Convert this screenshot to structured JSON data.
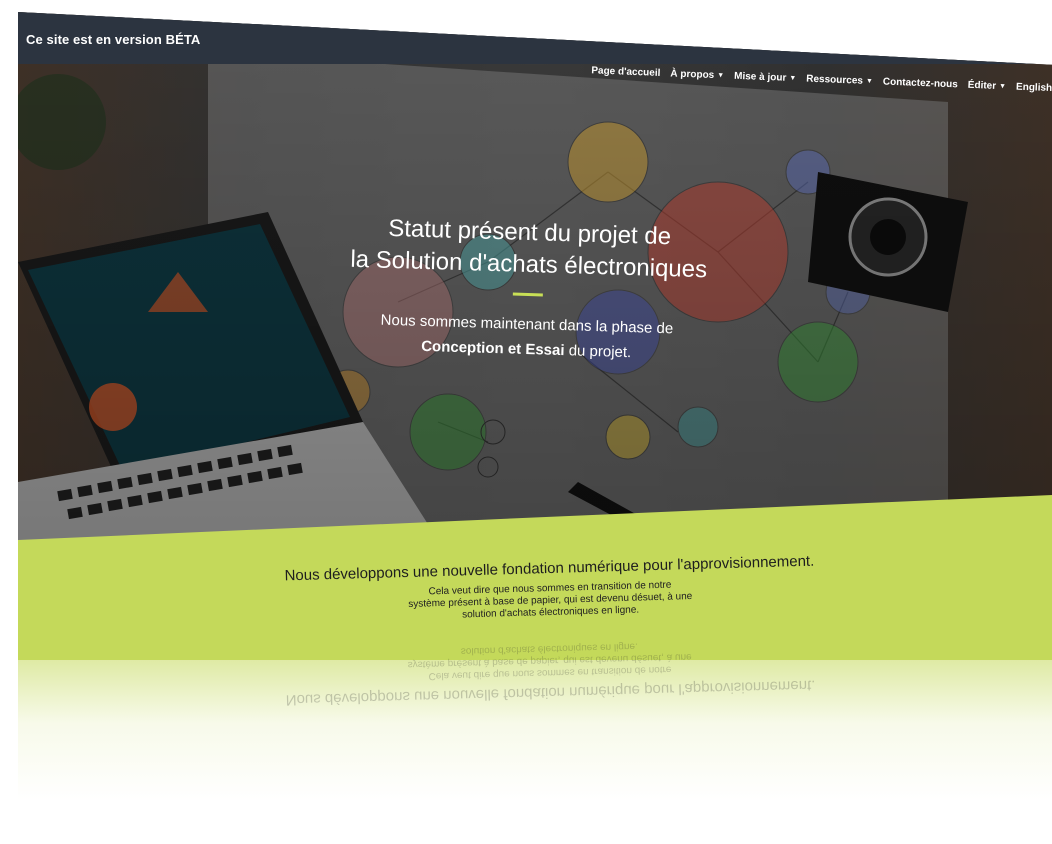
{
  "beta_notice": "Ce site est en version BÉTA",
  "nav": {
    "items": [
      {
        "label": "Page d'accueil",
        "caret": false
      },
      {
        "label": "À propos",
        "caret": true
      },
      {
        "label": "Mise à jour",
        "caret": true
      },
      {
        "label": "Ressources",
        "caret": true
      },
      {
        "label": "Contactez-nous",
        "caret": false
      },
      {
        "label": "Éditer",
        "caret": true
      },
      {
        "label": "English",
        "caret": false
      }
    ]
  },
  "hero": {
    "title_line1": "Statut présent du projet de",
    "title_line2": "la Solution d'achats électroniques",
    "subtitle_line1": "Nous sommes maintenant dans la phase de",
    "subtitle_bold": "Conception et Essai",
    "subtitle_rest": " du projet."
  },
  "band": {
    "title": "Nous développons une nouvelle fondation numérique pour l'approvisionnement.",
    "text_line1": "Cela veut dire que nous sommes en transition de notre",
    "text_line2": "système présent à base de papier, qui est devenu désuet, à une",
    "text_line3": "solution d'achats électroniques en ligne."
  },
  "colors": {
    "accent_green": "#c4d95a",
    "beta_bar": "#2c3440",
    "rule": "#c8df56"
  }
}
